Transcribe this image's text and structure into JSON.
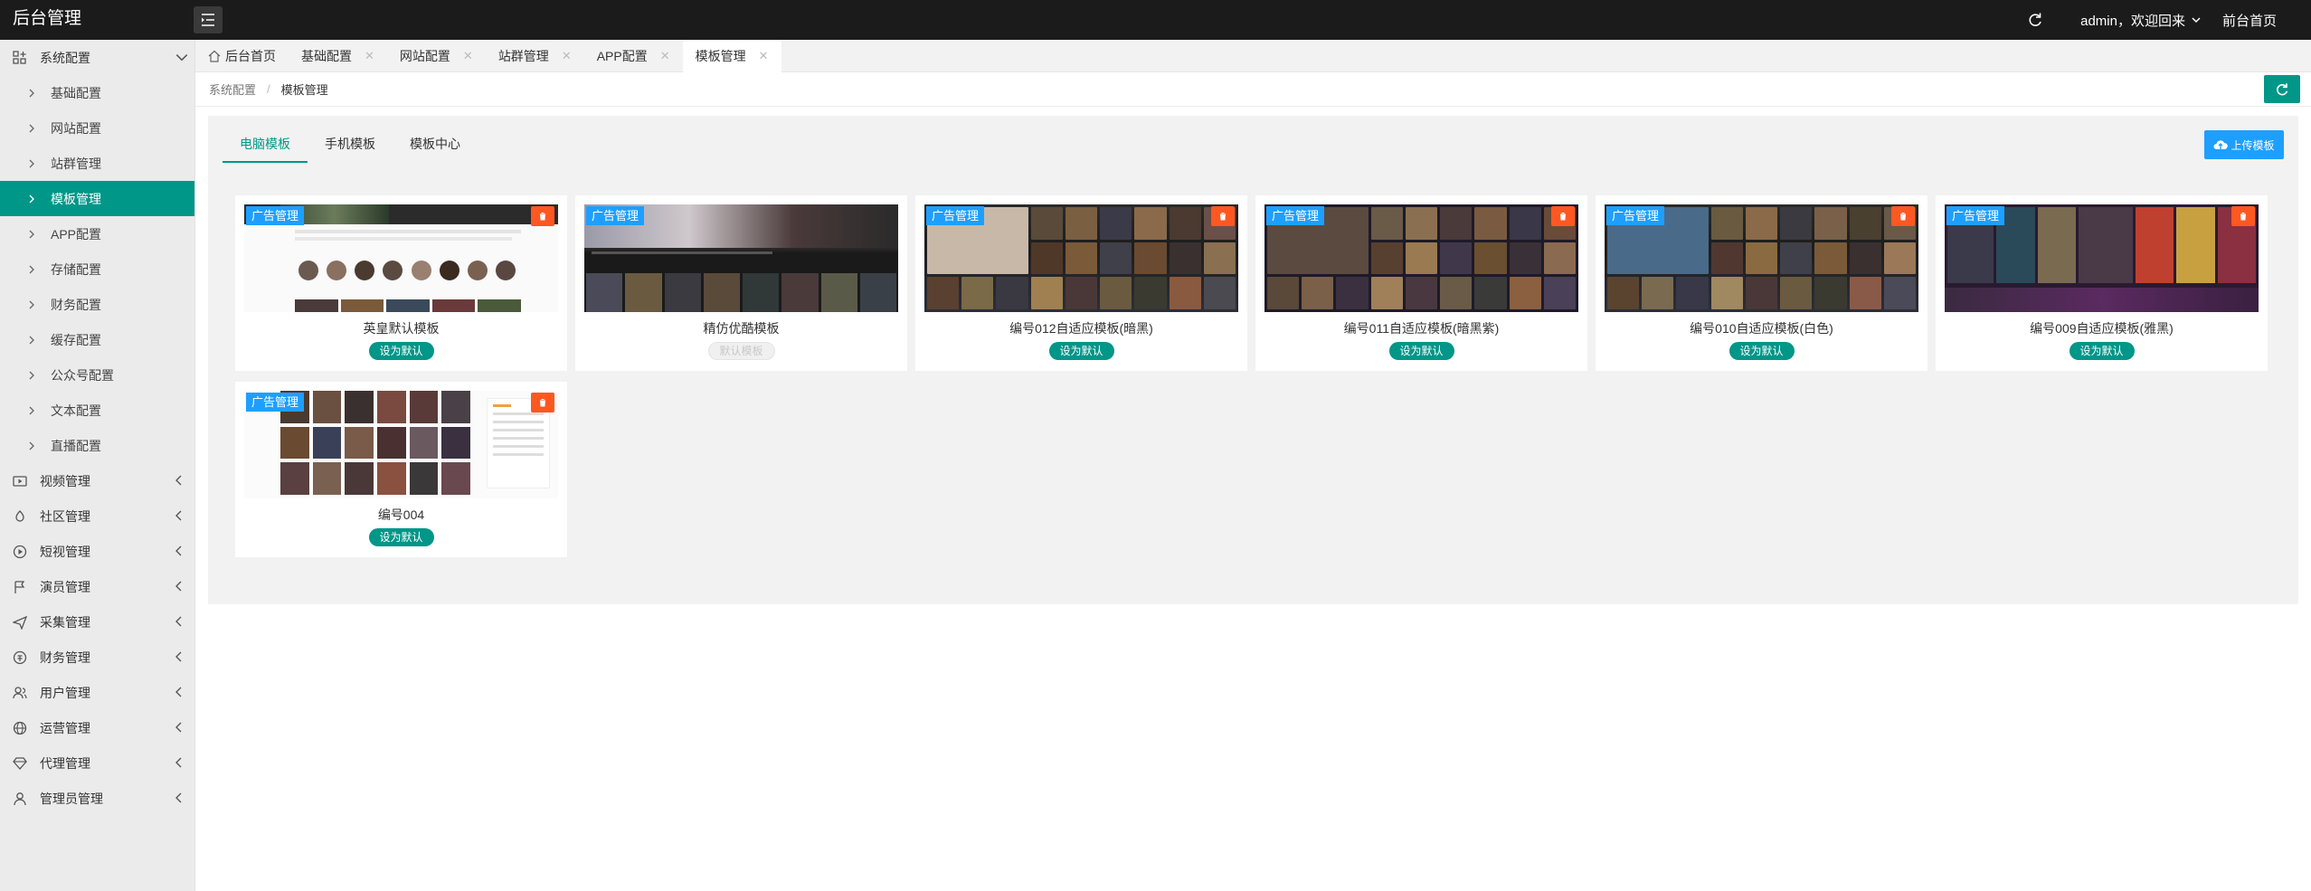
{
  "app": {
    "title": "后台管理"
  },
  "topbar": {
    "user_label": "admin，欢迎回来",
    "home_link": "前台首页"
  },
  "sidebar": {
    "items": [
      {
        "label": "系统配置",
        "icon": "settings-grid-icon",
        "expanded": true
      },
      {
        "label": "视频管理",
        "icon": "video-icon"
      },
      {
        "label": "社区管理",
        "icon": "community-icon"
      },
      {
        "label": "短视管理",
        "icon": "play-circle-icon"
      },
      {
        "label": "演员管理",
        "icon": "flag-icon"
      },
      {
        "label": "采集管理",
        "icon": "send-icon"
      },
      {
        "label": "财务管理",
        "icon": "wallet-icon"
      },
      {
        "label": "用户管理",
        "icon": "user-group-icon"
      },
      {
        "label": "运营管理",
        "icon": "globe-icon"
      },
      {
        "label": "代理管理",
        "icon": "diamond-icon"
      },
      {
        "label": "管理员管理",
        "icon": "user-icon"
      }
    ],
    "sub_items": [
      "基础配置",
      "网站配置",
      "站群管理",
      "模板管理",
      "APP配置",
      "存储配置",
      "财务配置",
      "缓存配置",
      "公众号配置",
      "文本配置",
      "直播配置"
    ],
    "active_sub": "模板管理"
  },
  "tabs": [
    {
      "label": "后台首页",
      "icon": "home-icon"
    },
    {
      "label": "基础配置"
    },
    {
      "label": "网站配置"
    },
    {
      "label": "站群管理"
    },
    {
      "label": "APP配置"
    },
    {
      "label": "模板管理",
      "active": true
    }
  ],
  "breadcrumb": {
    "parent": "系统配置",
    "separator": "/",
    "current": "模板管理"
  },
  "subtabs": [
    {
      "label": "电脑模板",
      "active": true
    },
    {
      "label": "手机模板"
    },
    {
      "label": "模板中心"
    }
  ],
  "upload_label": "上传模板",
  "ad_badge": "广告管理",
  "templates": [
    {
      "title": "英皇默认模板",
      "button": "设为默认",
      "style": "light"
    },
    {
      "title": "精仿优酷模板",
      "button": "默认模板",
      "style": "dark",
      "is_default": true
    },
    {
      "title": "编号012自适应模板(暗黑)",
      "button": "设为默认",
      "style": "dark"
    },
    {
      "title": "编号011自适应模板(暗黑紫)",
      "button": "设为默认",
      "style": "dark"
    },
    {
      "title": "编号010自适应模板(白色)",
      "button": "设为默认",
      "style": "dark"
    },
    {
      "title": "编号009自适应模板(雅黑)",
      "button": "设为默认",
      "style": "dark"
    },
    {
      "title": "编号004",
      "button": "设为默认",
      "style": "light"
    }
  ],
  "colors": {
    "primary": "#009688",
    "blue": "#1E9FFF",
    "danger": "#FF5722",
    "topbar": "#1b1b1b"
  }
}
